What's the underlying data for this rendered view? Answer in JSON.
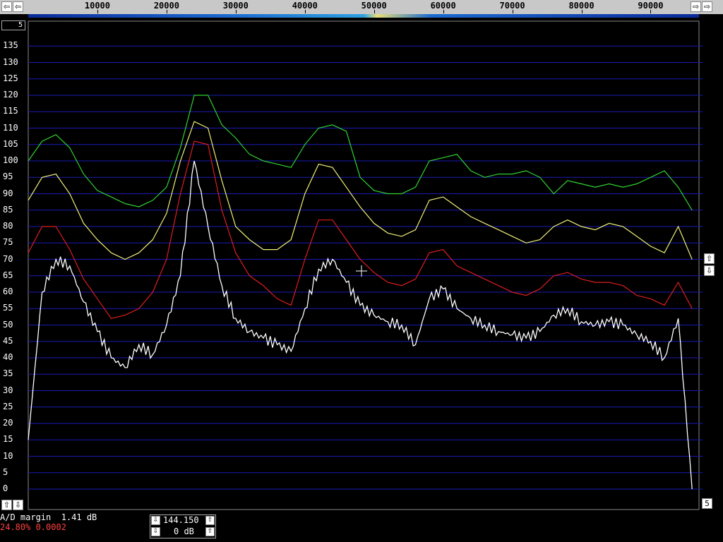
{
  "freq_axis": {
    "labels": [
      "10000",
      "20000",
      "30000",
      "40000",
      "50000",
      "60000",
      "70000",
      "80000",
      "90000"
    ]
  },
  "db_axis": {
    "labels": [
      "135",
      "130",
      "125",
      "120",
      "115",
      "110",
      "105",
      "100",
      "95",
      "90",
      "85",
      "80",
      "75",
      "70",
      "65",
      "60",
      "55",
      "50",
      "45",
      "40",
      "35",
      "30",
      "25",
      "20",
      "15",
      "10",
      "5",
      "0"
    ]
  },
  "buttons": {
    "scroll_left": "⇦",
    "scroll_left2": "⇦",
    "scroll_right": "⇨",
    "scroll_right2": "⇨",
    "zoom_in": "⇧",
    "zoom_out": "⇩",
    "bottom_up": "⇧",
    "bottom_down": "⇩",
    "right_value": "5"
  },
  "top_left_value": "5",
  "status": {
    "ad_margin": "A/D margin  1.41 dB",
    "level": "24.80% 0.0002"
  },
  "controls": {
    "frequency": "144.150",
    "gain": "0 dB",
    "freq_down": "⇩",
    "freq_up": "⇧",
    "gain_down": "⇩",
    "gain_up": "⇧"
  },
  "colors": {
    "grid": "#1a1ab4",
    "green": "#32d232",
    "yellow": "#f0f078",
    "red": "#dc1e1e",
    "white": "#ffffff"
  },
  "chart_data": {
    "type": "line",
    "x_range": [
      0,
      97000
    ],
    "y_range": [
      0,
      135
    ],
    "x": [
      0,
      2000,
      4000,
      6000,
      8000,
      10000,
      12000,
      14000,
      16000,
      18000,
      20000,
      22000,
      24000,
      26000,
      28000,
      30000,
      32000,
      34000,
      36000,
      38000,
      40000,
      42000,
      44000,
      46000,
      48000,
      50000,
      52000,
      54000,
      56000,
      58000,
      60000,
      62000,
      64000,
      66000,
      68000,
      70000,
      72000,
      74000,
      76000,
      78000,
      80000,
      82000,
      84000,
      86000,
      88000,
      90000,
      92000,
      94000,
      96000
    ],
    "series": [
      {
        "color": "green",
        "values": [
          100,
          106,
          108,
          104,
          96,
          91,
          89,
          87,
          86,
          88,
          92,
          104,
          120,
          120,
          111,
          107,
          102,
          100,
          99,
          98,
          105,
          110,
          111,
          109,
          95,
          91,
          90,
          90,
          92,
          100,
          101,
          102,
          97,
          95,
          96,
          96,
          97,
          95,
          90,
          94,
          93,
          92,
          93,
          92,
          93,
          95,
          97,
          92,
          85
        ]
      },
      {
        "color": "yellow",
        "values": [
          88,
          95,
          96,
          90,
          81,
          76,
          72,
          70,
          72,
          76,
          84,
          100,
          112,
          110,
          94,
          80,
          76,
          73,
          73,
          76,
          90,
          99,
          98,
          92,
          86,
          81,
          78,
          77,
          79,
          88,
          89,
          86,
          83,
          81,
          79,
          77,
          75,
          76,
          80,
          82,
          80,
          79,
          81,
          80,
          77,
          74,
          72,
          80,
          70
        ]
      },
      {
        "color": "red",
        "values": [
          72,
          80,
          80,
          73,
          64,
          58,
          52,
          53,
          55,
          60,
          70,
          90,
          106,
          105,
          85,
          72,
          65,
          62,
          58,
          56,
          70,
          82,
          82,
          76,
          70,
          66,
          63,
          62,
          64,
          72,
          73,
          68,
          66,
          64,
          62,
          60,
          59,
          61,
          65,
          66,
          64,
          63,
          63,
          62,
          59,
          58,
          56,
          63,
          55
        ]
      },
      {
        "color": "white",
        "values": [
          15,
          60,
          70,
          68,
          57,
          48,
          40,
          37,
          44,
          41,
          50,
          65,
          100,
          80,
          62,
          52,
          48,
          46,
          44,
          42,
          55,
          67,
          70,
          63,
          56,
          53,
          51,
          50,
          44,
          58,
          61,
          55,
          52,
          50,
          48,
          47,
          46,
          48,
          53,
          55,
          51,
          50,
          51,
          50,
          47,
          45,
          40,
          52,
          0
        ]
      }
    ]
  }
}
